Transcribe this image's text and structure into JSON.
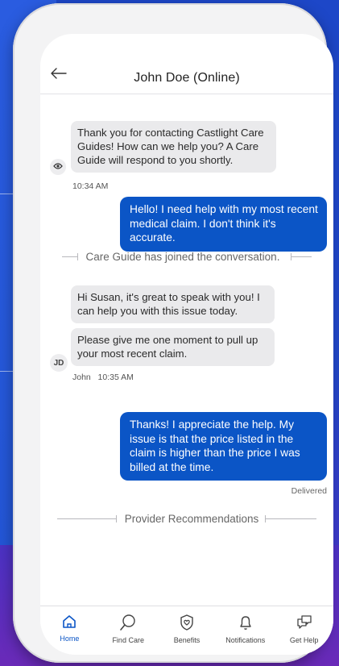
{
  "header": {
    "title": "John Doe (Online)"
  },
  "messages": {
    "agent_welcome": "Thank you for contacting Castlight Care Guides! How can we help you? A Care Guide will respond to you shortly.",
    "agent_welcome_time": "10:34 AM",
    "user_1": "Hello! I need help with my most recent medical claim. I don't think it's accurate.",
    "system_join": "Care Guide has joined the conversation.",
    "guide_1": "Hi Susan, it's great to speak with you! I can help you with this issue today.",
    "guide_2": "Please give me one moment to pull up your most recent claim.",
    "guide_avatar_initials": "JD",
    "guide_meta": "John   10:35 AM",
    "user_2": "Thanks! I appreciate the help. My issue is that the price listed in the claim is higher than the price I was billed at the time.",
    "user_2_status": "Delivered",
    "system_recommendations": "Provider Recommendations"
  },
  "nav": {
    "active": "home",
    "items": [
      {
        "id": "home",
        "label": "Home",
        "icon": "home-icon"
      },
      {
        "id": "find-care",
        "label": "Find Care",
        "icon": "search-icon"
      },
      {
        "id": "benefits",
        "label": "Benefits",
        "icon": "shield-heart-icon"
      },
      {
        "id": "notifications",
        "label": "Notifications",
        "icon": "bell-icon"
      },
      {
        "id": "get-help",
        "label": "Get Help",
        "icon": "chat-bubbles-icon"
      }
    ]
  },
  "colors": {
    "accent": "#0b55c6",
    "incoming_bubble": "#eaeaec",
    "background_gradient_top": "#1d47c8",
    "background_gradient_bottom": "#5a2bc0"
  }
}
